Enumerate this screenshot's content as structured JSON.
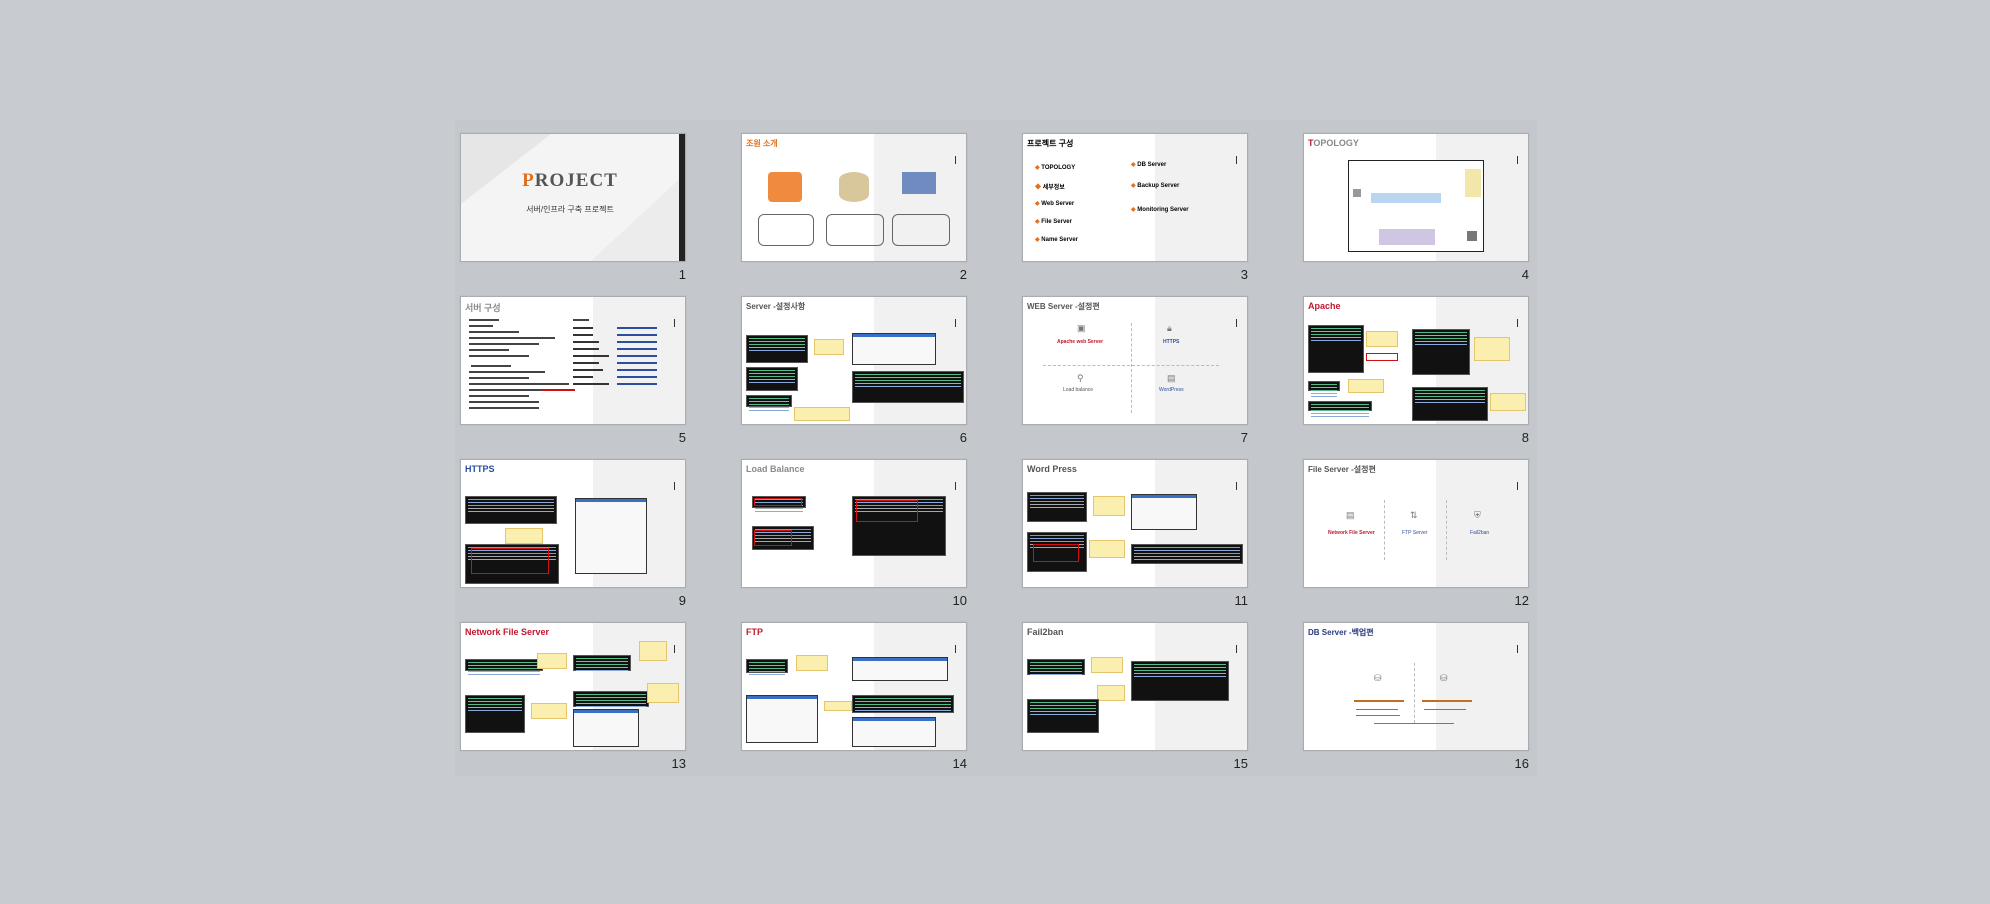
{
  "slides": [
    {
      "number": "1",
      "title_first": "P",
      "title_rest": "ROJECT",
      "subtitle": "서버/인프라 구축 프로젝트"
    },
    {
      "number": "2",
      "title": "조원 소개"
    },
    {
      "number": "3",
      "title": "프로젝트 구성",
      "items_left": [
        "TOPOLOGY",
        "세부정보",
        "Web Server",
        "File Server",
        "Name Server"
      ],
      "items_right": [
        "DB Server",
        "Backup Server",
        "Monitoring Server"
      ]
    },
    {
      "number": "4",
      "title_first": "T",
      "title_rest": "OPOLOGY"
    },
    {
      "number": "5",
      "title": "서버 구성"
    },
    {
      "number": "6",
      "title": "Server -설정사항"
    },
    {
      "number": "7",
      "title": "WEB Server -설정편",
      "cards": [
        "Apache web Server",
        "HTTPS",
        "Load balance",
        "WordPress"
      ]
    },
    {
      "number": "8",
      "title": "Apache"
    },
    {
      "number": "9",
      "title": "HTTPS"
    },
    {
      "number": "10",
      "title": "Load Balance"
    },
    {
      "number": "11",
      "title": "Word Press"
    },
    {
      "number": "12",
      "title": "File Server -설정편",
      "cards": [
        "Network File Server",
        "FTP Server",
        "Fail2ban"
      ]
    },
    {
      "number": "13",
      "title": "Network File Server"
    },
    {
      "number": "14",
      "title": "FTP"
    },
    {
      "number": "15",
      "title": "Fail2ban"
    },
    {
      "number": "16",
      "title": "DB Server -백업편"
    }
  ],
  "icons": {
    "web": "globe-window-icon",
    "db": "database-icon",
    "server": "server-rack-icon"
  }
}
